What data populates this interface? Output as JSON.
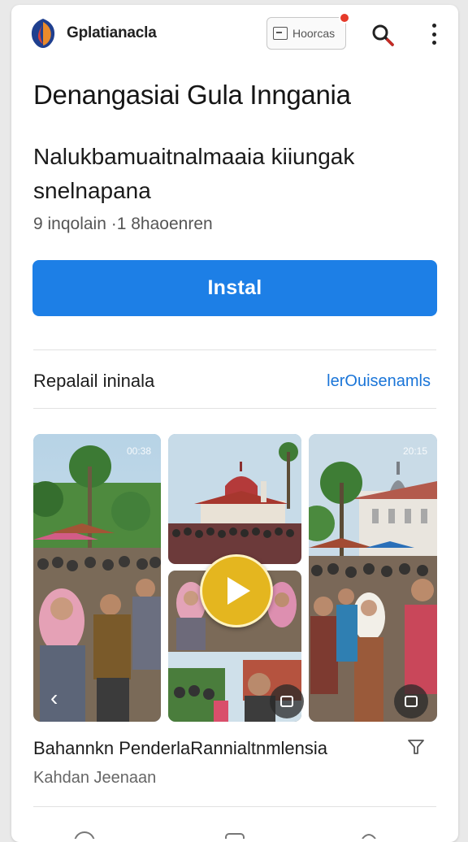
{
  "header": {
    "app_name": "Gplatianacla",
    "chip_label": "Hoorcas"
  },
  "app": {
    "title": "Denangasiai Gula Inngania",
    "subtitle": "Nalukbamuaitnalmaaia kiiungak snelnapana",
    "meta": "9 inqolain  ·1 8haoenren"
  },
  "install": {
    "label": "Instal"
  },
  "section": {
    "title": "Repalail ininala",
    "link": "lerOuisenamls"
  },
  "gallery": {
    "badge_left": "00:38",
    "badge_right": "20:15"
  },
  "caption": {
    "title": "Bahannkn PenderlaRannialtnmlensia",
    "subtitle": "Kahdan Jeenaan"
  },
  "colors": {
    "primary": "#1d7fe6",
    "link": "#1a75d8",
    "notification": "#e53a2a",
    "play": "#e4b61f"
  }
}
